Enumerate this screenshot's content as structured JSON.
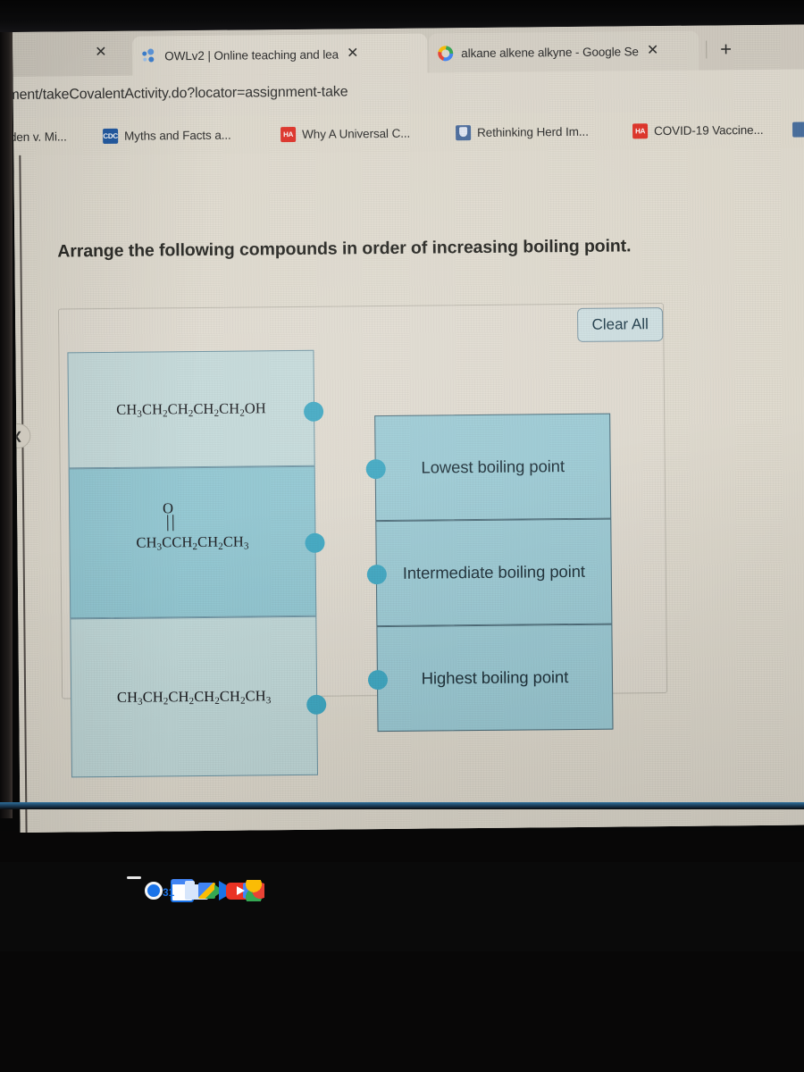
{
  "browser": {
    "tabs": [
      {
        "title": "OWLv2 | Online teaching and lea",
        "favicon": "owl-icon",
        "close_glyph": "✕",
        "active": true
      },
      {
        "title": "alkane alkene alkyne - Google Se",
        "favicon": "google-icon",
        "close_glyph": "✕",
        "active": false
      }
    ],
    "leading_close_glyph": "✕",
    "new_tab_glyph": "+",
    "url": "nment/takeCovalentActivity.do?locator=assignment-take",
    "bookmarks": [
      {
        "label": "Biden v. Mi...",
        "icon": ""
      },
      {
        "label": "Myths and Facts a...",
        "icon": "CDC"
      },
      {
        "label": "Why A Universal C...",
        "icon": "HA"
      },
      {
        "label": "Rethinking Herd Im...",
        "icon": "shield"
      },
      {
        "label": "COVID-19 Vaccine...",
        "icon": "HA"
      }
    ]
  },
  "activity": {
    "question": "Arrange the following compounds in order of increasing boiling point.",
    "clear_all_label": "Clear All",
    "edge_chevron_glyph": "❮",
    "compounds": [
      {
        "id": "compound-pentanol",
        "formula_head": "CH",
        "formula_plain": "CH3CH2CH2CH2CH2OH",
        "parts": [
          "CH",
          "3",
          "CH",
          "2",
          "CH",
          "2",
          "CH",
          "2",
          "CH",
          "2",
          "OH"
        ]
      },
      {
        "id": "compound-pentanone",
        "formula_plain": "CH3CCH2CH2CH3",
        "oxygen_label": "O",
        "left_parts": [
          "CH",
          "3",
          "C"
        ],
        "right_parts": [
          "CH",
          "2",
          "CH",
          "2",
          "CH",
          "3"
        ]
      },
      {
        "id": "compound-hexane",
        "formula_plain": "CH3CH2CH2CH2CH2CH3",
        "parts": [
          "CH",
          "3",
          "CH",
          "2",
          "CH",
          "2",
          "CH",
          "2",
          "CH",
          "2",
          "CH",
          "3"
        ]
      }
    ],
    "slots": [
      {
        "id": "slot-lowest",
        "label": "Lowest boiling point"
      },
      {
        "id": "slot-intermediate",
        "label": "Intermediate boiling point"
      },
      {
        "id": "slot-highest",
        "label": "Highest boiling point"
      }
    ]
  },
  "shelf": {
    "items": [
      {
        "name": "chrome-icon",
        "label": "Chrome",
        "running": true
      },
      {
        "name": "gmail-icon",
        "label": "Gmail",
        "running": false
      },
      {
        "name": "calendar-icon",
        "label": "Calendar",
        "running": false
      },
      {
        "name": "files-icon",
        "label": "Files",
        "running": false
      },
      {
        "name": "meet-icon",
        "label": "Google Meet",
        "running": false
      },
      {
        "name": "play-store-icon",
        "label": "Play Store",
        "running": false
      },
      {
        "name": "youtube-icon",
        "label": "YouTube",
        "running": false
      },
      {
        "name": "photos-icon",
        "label": "Photos",
        "running": false
      }
    ]
  },
  "colors": {
    "page_bg": "#e0dbcf",
    "card_light": "#c5dbdb",
    "card_dark": "#92c8d3",
    "slot_fill": "#9dccd6",
    "handle": "#3fa9c4",
    "border": "#4c6b78"
  }
}
